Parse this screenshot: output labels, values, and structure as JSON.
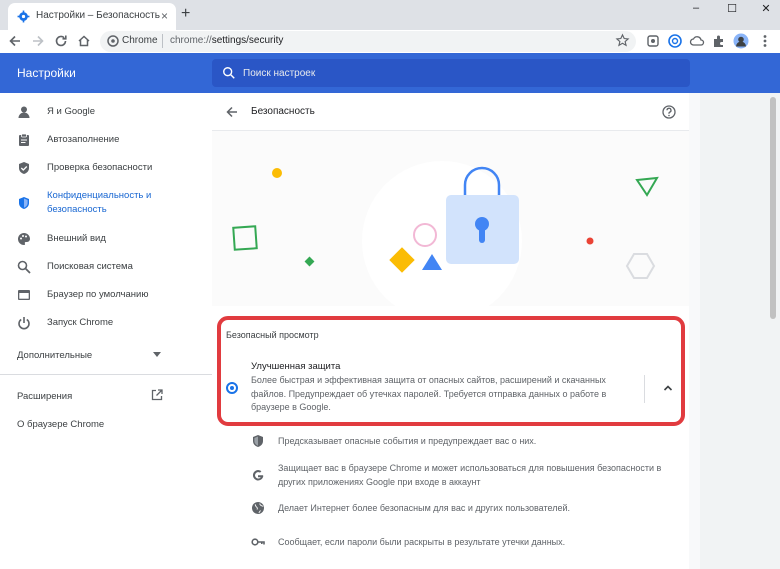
{
  "tab": {
    "title": "Настройки – Безопасность",
    "close": "×",
    "new_tab": "+"
  },
  "window": {
    "minimize": "–",
    "maximize": "☐",
    "close": "✕"
  },
  "omnibox": {
    "site": "Chrome",
    "url_host": "chrome://",
    "url_path": "settings/security"
  },
  "header": {
    "title": "Настройки",
    "search_placeholder": "Поиск настроек"
  },
  "sidebar": {
    "items": [
      {
        "label": "Я и Google",
        "icon": "person-icon"
      },
      {
        "label": "Автозаполнение",
        "icon": "clipboard-icon"
      },
      {
        "label": "Проверка безопасности",
        "icon": "shield-check-icon"
      },
      {
        "label_line1": "Конфиденциальность и",
        "label_line2": "безопасность",
        "icon": "shield-icon",
        "active": true
      },
      {
        "label": "Внешний вид",
        "icon": "palette-icon"
      },
      {
        "label": "Поисковая система",
        "icon": "search-icon"
      },
      {
        "label": "Браузер по умолчанию",
        "icon": "browser-icon"
      },
      {
        "label": "Запуск Chrome",
        "icon": "power-icon"
      }
    ],
    "advanced": "Дополнительные",
    "extensions": "Расширения",
    "about": "О браузере Chrome"
  },
  "main": {
    "title": "Безопасность",
    "section_heading": "Безопасный просмотр",
    "option": {
      "title": "Улучшенная защита",
      "description": "Более быстрая и эффективная защита от опасных сайтов, расширений и скачанных файлов. Предупреждает об утечках паролей. Требуется отправка данных о работе в браузере в Google."
    },
    "features": [
      {
        "icon": "shield-icon",
        "text": "Предсказывает опасные события и предупреждает вас о них."
      },
      {
        "icon": "google-g-icon",
        "text": "Защищает вас в браузере Chrome и может использоваться для повышения безопасности в других приложениях Google при входе в аккаунт"
      },
      {
        "icon": "globe-icon",
        "text": "Делает Интернет более безопасным для вас и других пользователей."
      },
      {
        "icon": "key-icon",
        "text": "Сообщает, если пароли были раскрыты в результате утечки данных."
      }
    ]
  },
  "colors": {
    "header": "#3367d6",
    "accent": "#1a73e8",
    "highlight": "#e13b3f"
  }
}
